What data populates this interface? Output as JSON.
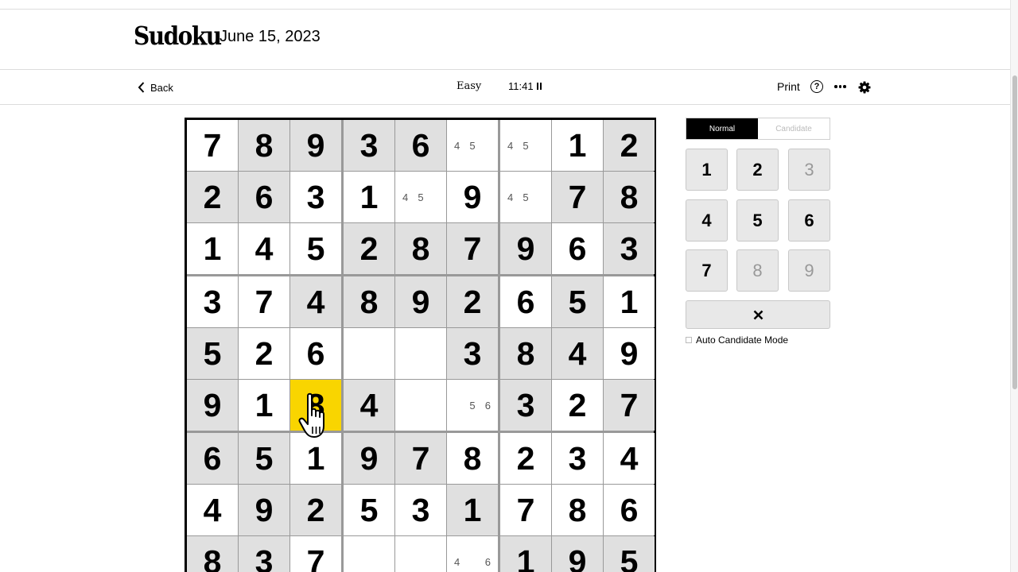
{
  "header": {
    "title": "Sudoku",
    "date": "June 15, 2023"
  },
  "toolbar": {
    "back_label": "Back",
    "difficulty": "Easy",
    "timer": "11:41",
    "print_label": "Print",
    "help_symbol": "?"
  },
  "board": {
    "selected": {
      "row": 5,
      "col": 2
    },
    "rows": [
      [
        "7",
        "8",
        "9",
        "3",
        "6",
        "",
        "",
        "1",
        "2"
      ],
      [
        "2",
        "6",
        "3",
        "1",
        "",
        "9",
        "",
        "7",
        "8"
      ],
      [
        "1",
        "4",
        "5",
        "2",
        "8",
        "7",
        "9",
        "6",
        "3"
      ],
      [
        "3",
        "7",
        "4",
        "8",
        "9",
        "2",
        "6",
        "5",
        "1"
      ],
      [
        "5",
        "2",
        "6",
        "",
        "",
        "3",
        "8",
        "4",
        "9"
      ],
      [
        "9",
        "1",
        "8",
        "4",
        "",
        "",
        "3",
        "2",
        "7"
      ],
      [
        "6",
        "5",
        "1",
        "9",
        "7",
        "8",
        "2",
        "3",
        "4"
      ],
      [
        "4",
        "9",
        "2",
        "5",
        "3",
        "1",
        "7",
        "8",
        "6"
      ],
      [
        "8",
        "3",
        "7",
        "",
        "",
        "",
        "1",
        "9",
        "5"
      ]
    ],
    "candidates": {
      "0-5": [
        "4",
        "5"
      ],
      "0-6": [
        "4",
        "5"
      ],
      "1-4": [
        "4",
        "5"
      ],
      "1-6": [
        "4",
        "5"
      ],
      "5-5": [
        "5",
        "6"
      ],
      "8-5": [
        "4",
        "6"
      ]
    },
    "shaded": [
      [
        false,
        true,
        true,
        true,
        true,
        false,
        false,
        false,
        true
      ],
      [
        true,
        true,
        false,
        false,
        false,
        false,
        false,
        true,
        true
      ],
      [
        false,
        false,
        false,
        true,
        true,
        true,
        true,
        false,
        true
      ],
      [
        false,
        false,
        true,
        true,
        true,
        true,
        false,
        true,
        false
      ],
      [
        true,
        false,
        false,
        false,
        false,
        true,
        true,
        true,
        false
      ],
      [
        true,
        false,
        false,
        true,
        false,
        false,
        true,
        false,
        true
      ],
      [
        true,
        true,
        false,
        true,
        true,
        false,
        false,
        false,
        false
      ],
      [
        false,
        true,
        true,
        false,
        false,
        true,
        false,
        false,
        false
      ],
      [
        true,
        true,
        false,
        false,
        false,
        false,
        true,
        true,
        true
      ]
    ]
  },
  "controls": {
    "modes": [
      "Normal",
      "Candidate"
    ],
    "active_mode": "Normal",
    "numpad": [
      {
        "label": "1",
        "disabled": false
      },
      {
        "label": "2",
        "disabled": false
      },
      {
        "label": "3",
        "disabled": true
      },
      {
        "label": "4",
        "disabled": false
      },
      {
        "label": "5",
        "disabled": false
      },
      {
        "label": "6",
        "disabled": false
      },
      {
        "label": "7",
        "disabled": false
      },
      {
        "label": "8",
        "disabled": true
      },
      {
        "label": "9",
        "disabled": true
      }
    ],
    "auto_candidate_label": "Auto Candidate Mode",
    "auto_candidate_checked": false
  },
  "colors": {
    "selected_cell": "#f9d500",
    "shaded_cell": "#e0e0e0",
    "active_mode_bg": "#000000"
  },
  "icons": [
    "chevron-left-icon",
    "pause-icon",
    "help-icon",
    "more-icon",
    "gear-icon",
    "close-icon",
    "hand-cursor-icon"
  ]
}
